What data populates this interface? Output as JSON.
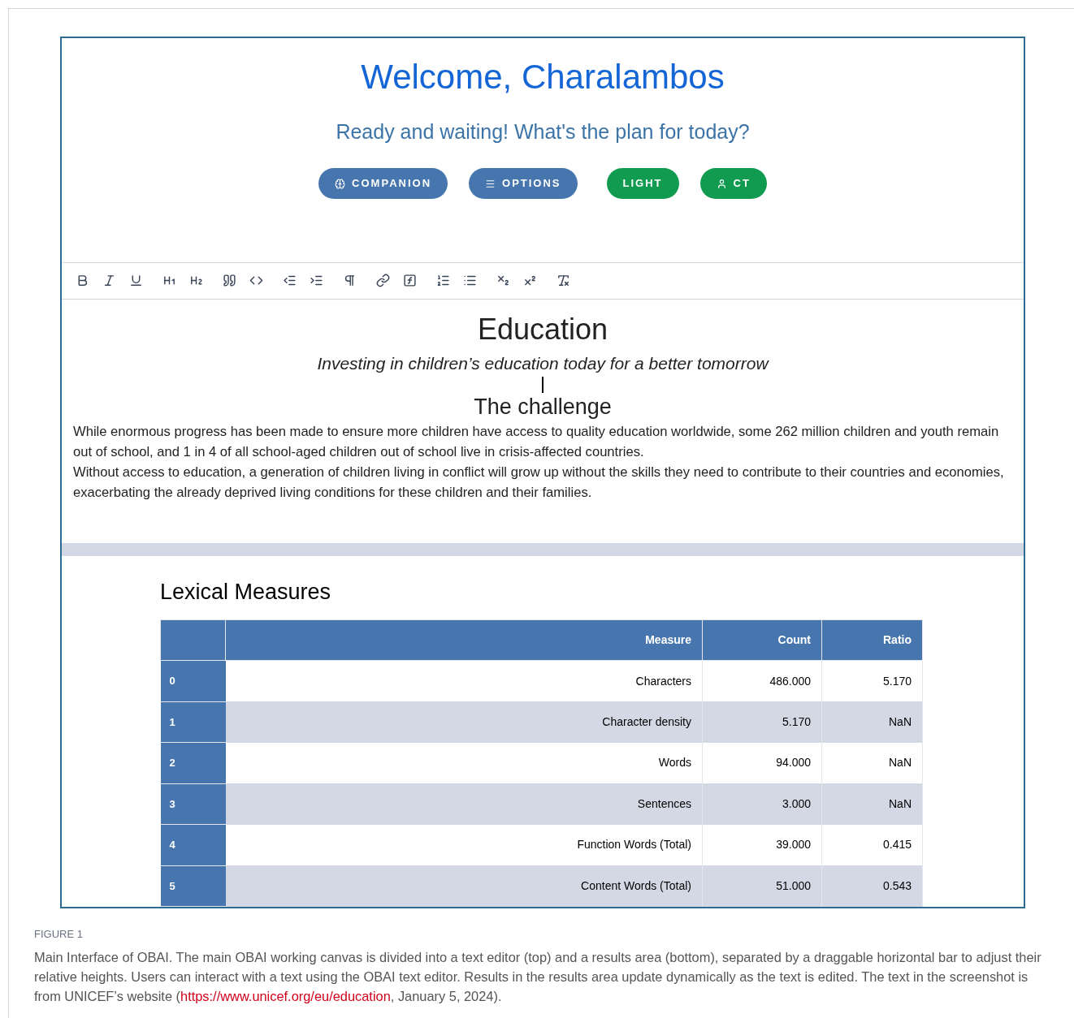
{
  "header": {
    "greeting": "Welcome, Charalambos",
    "tagline": "Ready and waiting! What's the plan for today?",
    "buttons": [
      {
        "label": "COMPANION",
        "color": "#4676ad"
      },
      {
        "label": "OPTIONS",
        "color": "#4676ad"
      },
      {
        "label": "LIGHT",
        "color": "#109b50"
      },
      {
        "label": "CT",
        "color": "#109b50"
      }
    ]
  },
  "editor": {
    "title": "Education",
    "subtitle": "Investing in children’s education today for a better tomorrow",
    "cursor": true,
    "heading": "The challenge",
    "paragraphs": [
      "While enormous progress has been made to ensure more children have access to quality education worldwide, some 262 million children and youth remain out of school, and 1 in 4 of all school-aged children out of school live in crisis-affected countries.",
      "Without access to education, a generation of children living in conflict will grow up without the skills they need to contribute to their countries and economies, exacerbating the already deprived living conditions for these children and their families."
    ]
  },
  "results": {
    "title": "Lexical Measures",
    "table": {
      "columns": [
        "Measure",
        "Count",
        "Ratio"
      ],
      "rows": [
        {
          "index": "0",
          "cells": [
            "Characters",
            "486.000",
            "5.170"
          ]
        },
        {
          "index": "1",
          "cells": [
            "Character density",
            "5.170",
            "NaN"
          ]
        },
        {
          "index": "2",
          "cells": [
            "Words",
            "94.000",
            "NaN"
          ]
        },
        {
          "index": "3",
          "cells": [
            "Sentences",
            "3.000",
            "NaN"
          ]
        },
        {
          "index": "4",
          "cells": [
            "Function Words (Total)",
            "39.000",
            "0.415"
          ]
        },
        {
          "index": "5",
          "cells": [
            "Content Words (Total)",
            "51.000",
            "0.543"
          ]
        }
      ]
    }
  },
  "figure": {
    "label": "FIGURE 1",
    "caption_before": "Main Interface of OBAI. The main OBAI working canvas is divided into a text editor (top) and a results area (bottom), separated by a draggable horizontal bar to adjust their relative heights. Users can interact with a text using the OBAI text editor. Results in the results area update dynamically as the text is edited. The text in the screenshot is from UNICEF’s website (",
    "link": "https://www.unicef.org/eu/education",
    "caption_after": ", January 5, 2024)."
  }
}
